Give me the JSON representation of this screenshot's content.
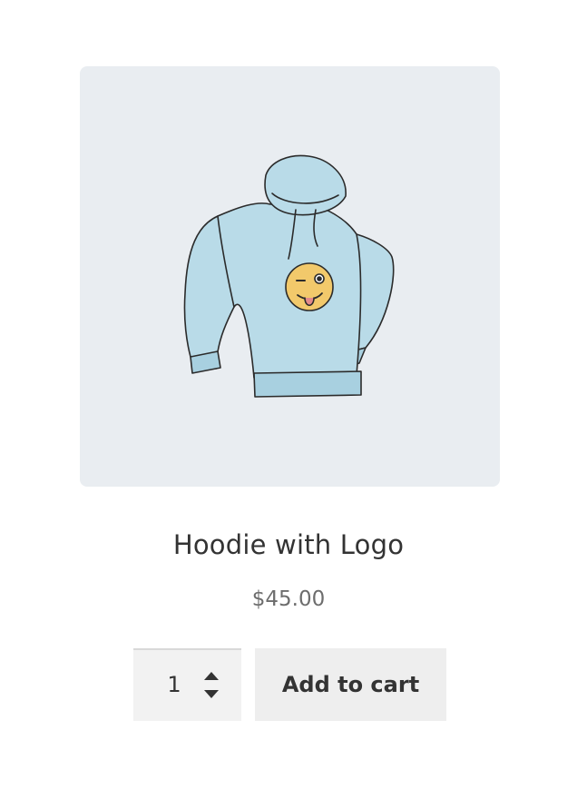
{
  "product": {
    "image_alt": "Hoodie with Logo",
    "title": "Hoodie with Logo",
    "price": "$45.00"
  },
  "cart_form": {
    "quantity": "1",
    "add_to_cart_label": "Add to cart"
  },
  "colors": {
    "image_background": "#e9edf1",
    "hoodie_fill": "#b9dbe8",
    "logo_fill": "#f2c96b",
    "button_background": "#eeeeee"
  }
}
